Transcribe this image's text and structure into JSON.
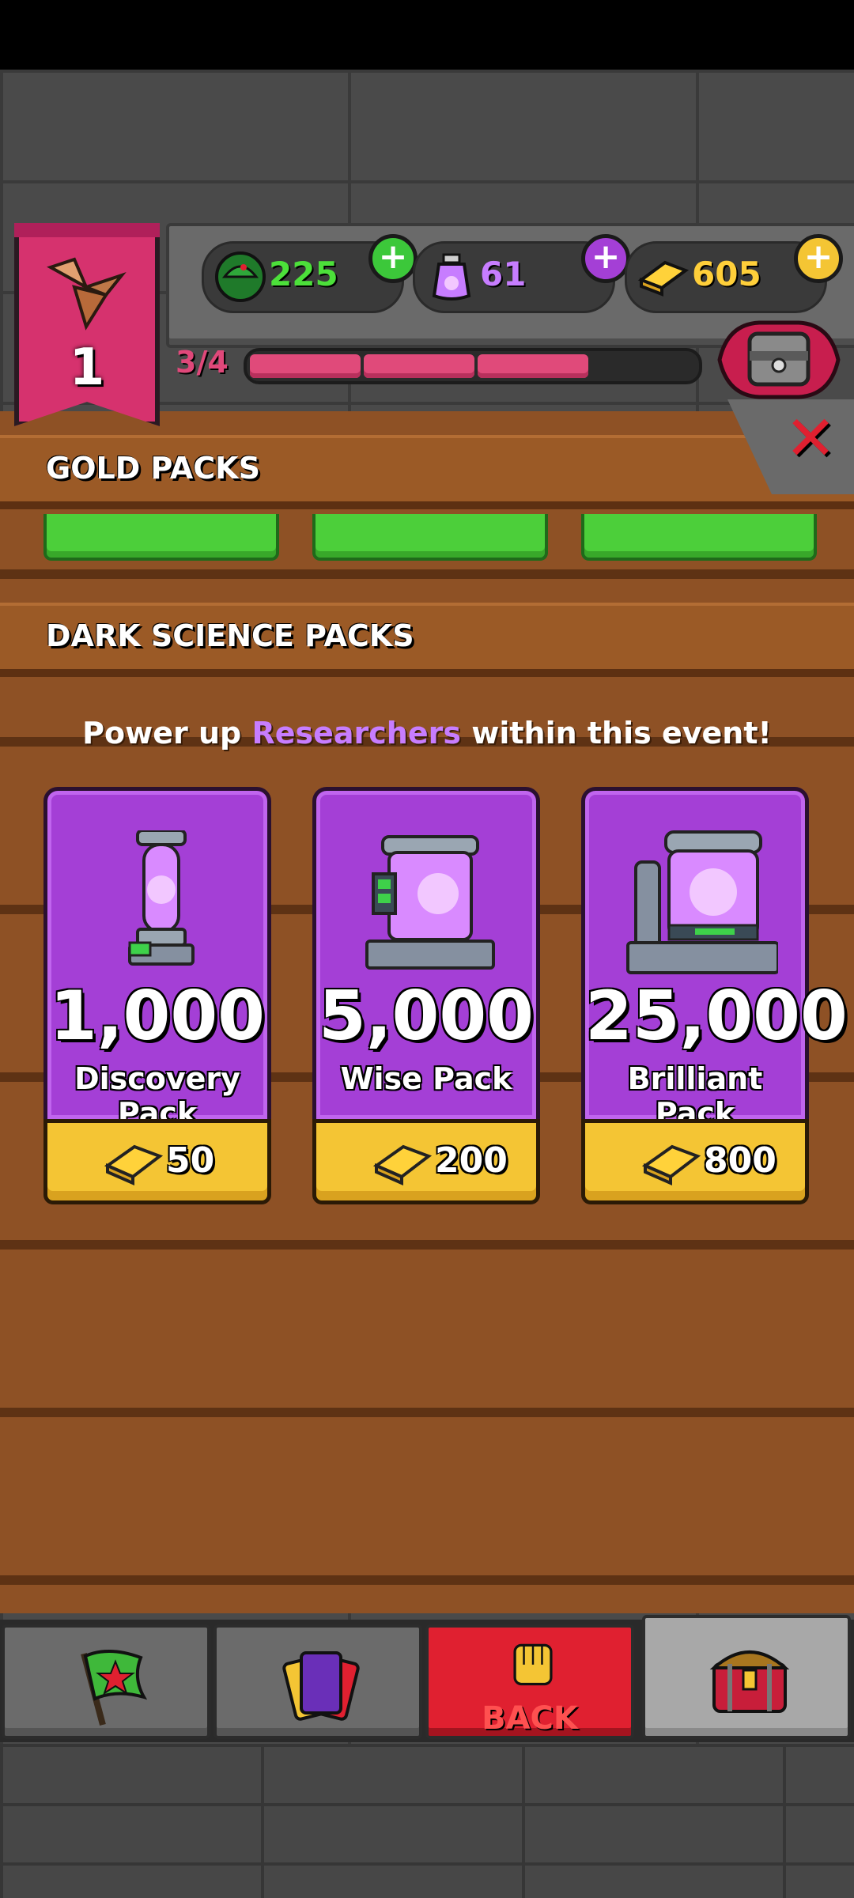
{
  "header": {
    "rank": "1",
    "progress_label": "3/4",
    "progress_fraction": 0.75,
    "resources": [
      {
        "name": "soldiers",
        "value": "225",
        "color": "#4ce03a",
        "plus_color": "#3cc83a"
      },
      {
        "name": "dark-science",
        "value": "61",
        "color": "#c77dff",
        "plus_color": "#a43fd6"
      },
      {
        "name": "gold",
        "value": "605",
        "color": "#ffcf3a",
        "plus_color": "#f4c534"
      }
    ]
  },
  "sections": {
    "gold_packs_title": "GOLD PACKS",
    "dark_science_title": "DARK SCIENCE PACKS"
  },
  "tagline": {
    "before": "Power up ",
    "highlight": "Researchers",
    "after": " within this event!"
  },
  "packs": [
    {
      "amount": "1,000",
      "name": "Discovery Pack",
      "price": "50",
      "icon": "small-tube-icon"
    },
    {
      "amount": "5,000",
      "name": "Wise Pack",
      "price": "200",
      "icon": "medium-tank-icon"
    },
    {
      "amount": "25,000",
      "name": "Brilliant Pack",
      "price": "800",
      "icon": "large-reactor-icon"
    }
  ],
  "nav": {
    "back_label": "BACK"
  },
  "colors": {
    "accent_pink": "#d6326e",
    "card_purple": "#a43fd6",
    "price_yellow": "#f4c534",
    "back_red": "#e02030"
  }
}
